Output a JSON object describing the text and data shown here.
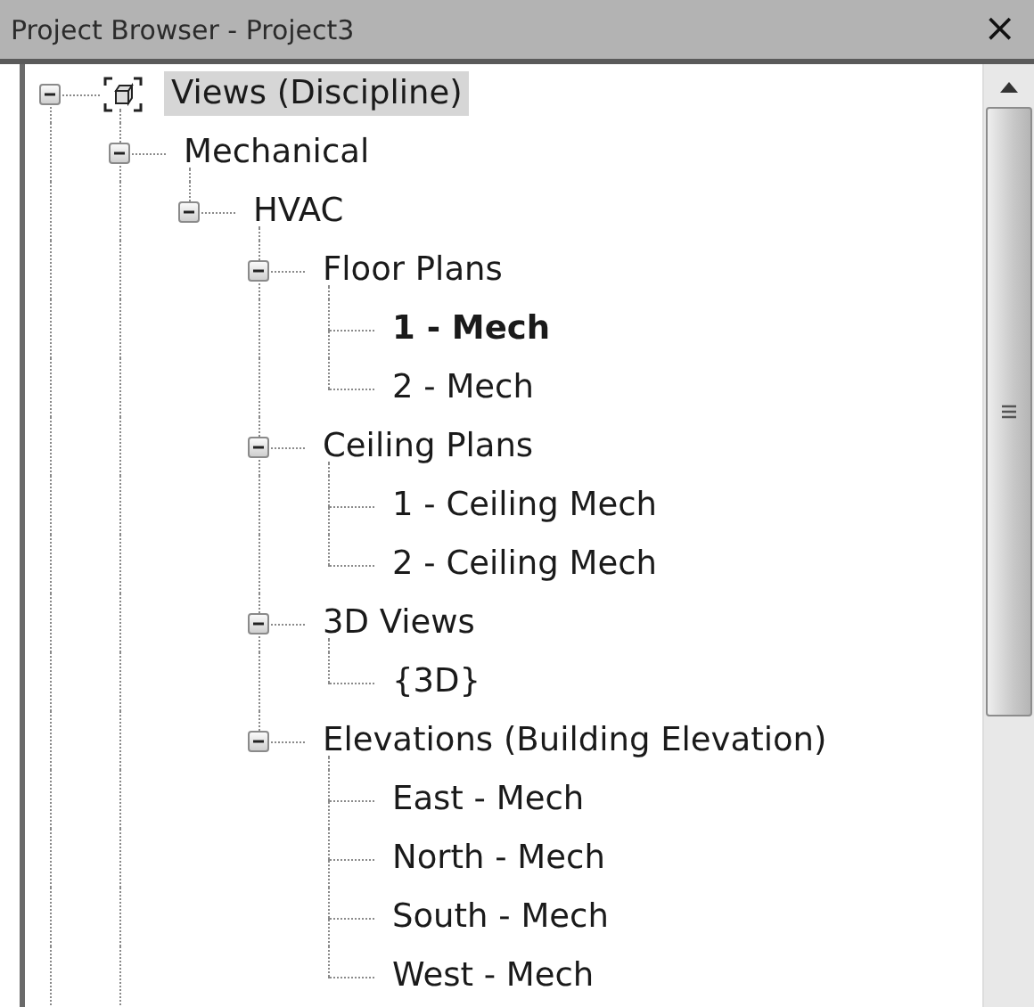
{
  "window": {
    "title": "Project Browser - Project3",
    "close": "×"
  },
  "tree": [
    {
      "label": "Views (Discipline)",
      "kind": "root",
      "selected": true,
      "current": false,
      "expanded": true,
      "more_below": true,
      "children": [
        {
          "label": "Mechanical",
          "selected": false,
          "current": false,
          "expanded": true,
          "more_below": true,
          "children": [
            {
              "label": "HVAC",
              "selected": false,
              "current": false,
              "expanded": true,
              "more_below": false,
              "children": [
                {
                  "label": "Floor Plans",
                  "selected": false,
                  "current": false,
                  "expanded": true,
                  "more_below": false,
                  "children": [
                    {
                      "label": "1 - Mech",
                      "selected": false,
                      "current": true
                    },
                    {
                      "label": "2 - Mech",
                      "selected": false,
                      "current": false
                    }
                  ]
                },
                {
                  "label": "Ceiling Plans",
                  "selected": false,
                  "current": false,
                  "expanded": true,
                  "more_below": false,
                  "children": [
                    {
                      "label": "1 - Ceiling Mech",
                      "selected": false,
                      "current": false
                    },
                    {
                      "label": "2 - Ceiling Mech",
                      "selected": false,
                      "current": false
                    }
                  ]
                },
                {
                  "label": "3D Views",
                  "selected": false,
                  "current": false,
                  "expanded": true,
                  "more_below": false,
                  "children": [
                    {
                      "label": "{3D}",
                      "selected": false,
                      "current": false
                    }
                  ]
                },
                {
                  "label": "Elevations (Building Elevation)",
                  "selected": false,
                  "current": false,
                  "expanded": true,
                  "more_below": false,
                  "children": [
                    {
                      "label": "East - Mech",
                      "selected": false,
                      "current": false
                    },
                    {
                      "label": "North - Mech",
                      "selected": false,
                      "current": false
                    },
                    {
                      "label": "South - Mech",
                      "selected": false,
                      "current": false
                    },
                    {
                      "label": "West - Mech",
                      "selected": false,
                      "current": false
                    }
                  ]
                }
              ]
            }
          ]
        }
      ]
    }
  ]
}
